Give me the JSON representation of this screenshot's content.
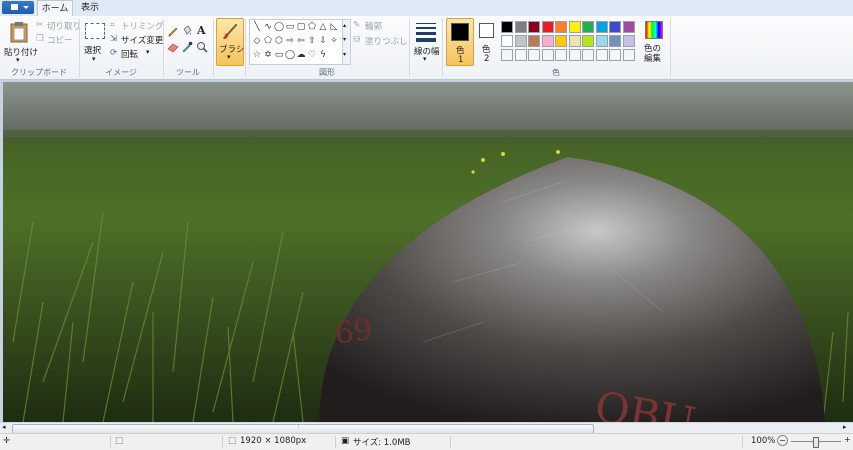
{
  "tabs": [
    "ホーム",
    "表示"
  ],
  "groups": {
    "clipboard": {
      "label": "クリップボード",
      "paste": "貼り付け",
      "cut": "切り取り",
      "copy": "コピー"
    },
    "image": {
      "label": "イメージ",
      "select": "選択",
      "crop": "トリミング",
      "resize": "サイズ変更",
      "rotate": "回転"
    },
    "tools": {
      "label": "ツール"
    },
    "brush": {
      "label": "ブラシ"
    },
    "shapes": {
      "label": "図形",
      "outline": "輪郭",
      "fill": "塗りつぶし"
    },
    "size": {
      "label": "線の幅"
    },
    "colors": {
      "label": "色",
      "color1": "色",
      "color1_num": "1",
      "color2": "色",
      "color2_num": "2",
      "edit_colors_1": "色の",
      "edit_colors_2": "編集",
      "color1_value": "#000000",
      "color2_value": "#ffffff",
      "palette_row1": [
        "#000000",
        "#7f7f7f",
        "#880015",
        "#ed1c24",
        "#ff7f27",
        "#fff200",
        "#22b14c",
        "#00a2e8",
        "#3f48cc",
        "#a349a4"
      ],
      "palette_row2": [
        "#ffffff",
        "#c3c3c3",
        "#b97a57",
        "#ffaec9",
        "#ffc90e",
        "#efe4b0",
        "#b5e61d",
        "#99d9ea",
        "#7092be",
        "#c8bfe7"
      ]
    }
  },
  "photo_text": {
    "number": "69",
    "word": "OBU"
  },
  "status": {
    "dimensions": "1920 × 1080px",
    "size": "サイズ: 1.0MB",
    "zoom": "100%",
    "zoom_out": "−",
    "zoom_in": "+",
    "zoom_level_fraction": 0.5
  }
}
